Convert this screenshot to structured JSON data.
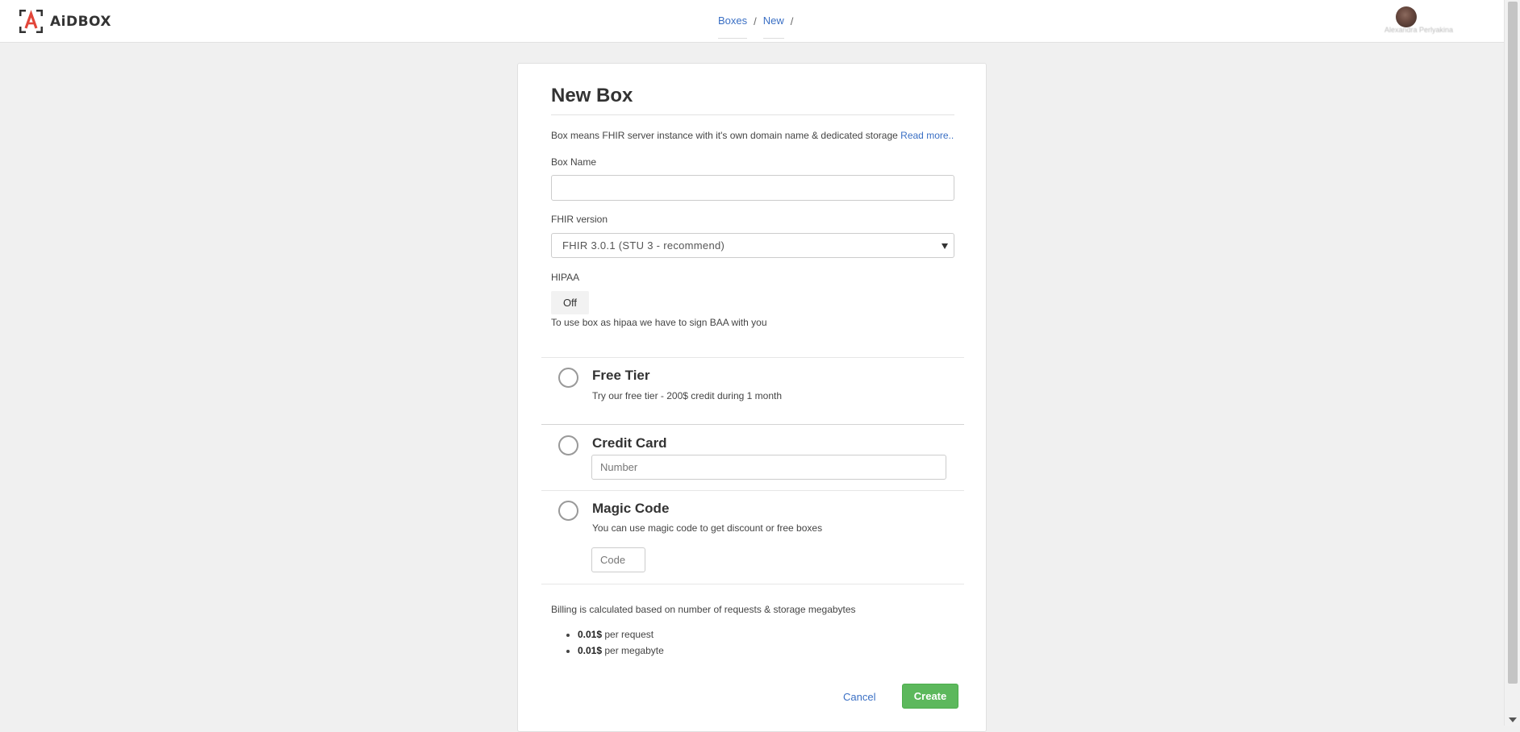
{
  "header": {
    "logo_text": "AiDBOX",
    "breadcrumb": [
      "Boxes",
      "New"
    ],
    "breadcrumb_separator": "/",
    "user_name": "Alexandra Perlyakina"
  },
  "form": {
    "title": "New Box",
    "description": "Box means FHIR server instance with it's own domain name & dedicated storage",
    "read_more": "Read more..",
    "box_name_label": "Box Name",
    "box_name_value": "",
    "fhir_version_label": "FHIR version",
    "fhir_version_value": "FHIR 3.0.1 (STU 3 - recommend)",
    "hipaa_label": "HIPAA",
    "hipaa_toggle": "Off",
    "hipaa_hint": "To use box as hipaa we have to sign BAA with you"
  },
  "options": [
    {
      "title": "Free Tier",
      "description": "Try our free tier - 200$ credit during 1 month"
    },
    {
      "title": "Credit Card",
      "input_placeholder": "Number"
    },
    {
      "title": "Magic Code",
      "description": "You can use magic code to get discount or free boxes",
      "input_placeholder": "Code"
    }
  ],
  "billing": {
    "text": "Billing is calculated based on number of requests & storage megabytes",
    "items": [
      {
        "price": "0.01$",
        "unit": "per request"
      },
      {
        "price": "0.01$",
        "unit": "per megabyte"
      }
    ]
  },
  "actions": {
    "cancel": "Cancel",
    "create": "Create"
  },
  "colors": {
    "accent": "#3a6fc4",
    "create_button": "#5cb85c",
    "logo_red": "#e2463a"
  }
}
